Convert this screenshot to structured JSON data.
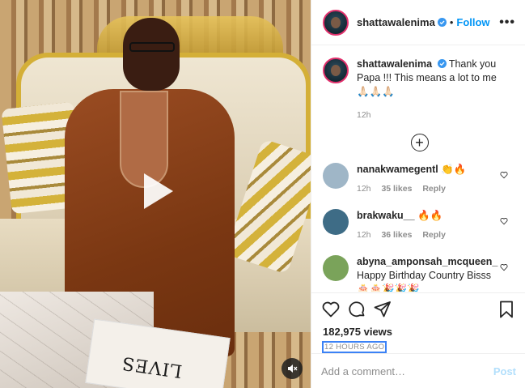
{
  "post": {
    "username": "shattawalenima",
    "follow_label": "Follow",
    "dot": "•",
    "more": "•••"
  },
  "caption": {
    "username": "shattawalenima",
    "text": "Thank you Papa !!! This means a lot to me 🙏🏻🙏🏻🙏🏻",
    "time": "12h"
  },
  "load_more": "+",
  "comments": [
    {
      "username": "nanakwamegentl",
      "text": "👏🔥",
      "time": "12h",
      "likes": "35 likes",
      "reply": "Reply",
      "avatar_color": "#9fb6c7"
    },
    {
      "username": "brakwaku__",
      "text": "🔥🔥",
      "time": "12h",
      "likes": "36 likes",
      "reply": "Reply",
      "avatar_color": "#3e6c86"
    },
    {
      "username": "abyna_amponsah_mcqueen_",
      "text": "Happy Birthday Country Bisss 🎂🎂🎉🎉🎉",
      "time": "",
      "likes": "",
      "reply": "",
      "avatar_color": "#7aa35a"
    }
  ],
  "stats": {
    "views": "182,975 views",
    "posted": "12 HOURS AGO"
  },
  "add_comment": {
    "placeholder": "Add a comment…",
    "post_label": "Post"
  },
  "video": {
    "book_text": "LIVES"
  },
  "colors": {
    "accent": "#0095f6",
    "verified": "#3897f0",
    "muted": "#8e8e8e"
  }
}
